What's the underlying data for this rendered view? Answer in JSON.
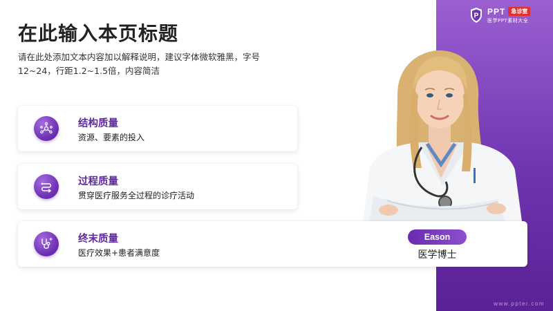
{
  "header": {
    "title": "在此输入本页标题",
    "description": "请在此处添加文本内容加以解释说明，建议字体微软雅黑，字号12~24，行距1.2~1.5倍，内容简洁"
  },
  "brand": {
    "name": "PPT",
    "tag": "急诊室",
    "subtitle": "医学PPT素材大全",
    "website": "www.ppter.com",
    "accent_color": "#6f35b0"
  },
  "items": [
    {
      "title": "结构质量",
      "text": "资源、要素的投入",
      "icon": "network-icon"
    },
    {
      "title": "过程质量",
      "text": "贯穿医疗服务全过程的诊疗活动",
      "icon": "flow-icon"
    },
    {
      "title": "终末质量",
      "text": "医疗效果+患者满意度",
      "icon": "stethoscope-icon"
    }
  ],
  "person": {
    "name": "Eason",
    "role": "医学博士"
  }
}
